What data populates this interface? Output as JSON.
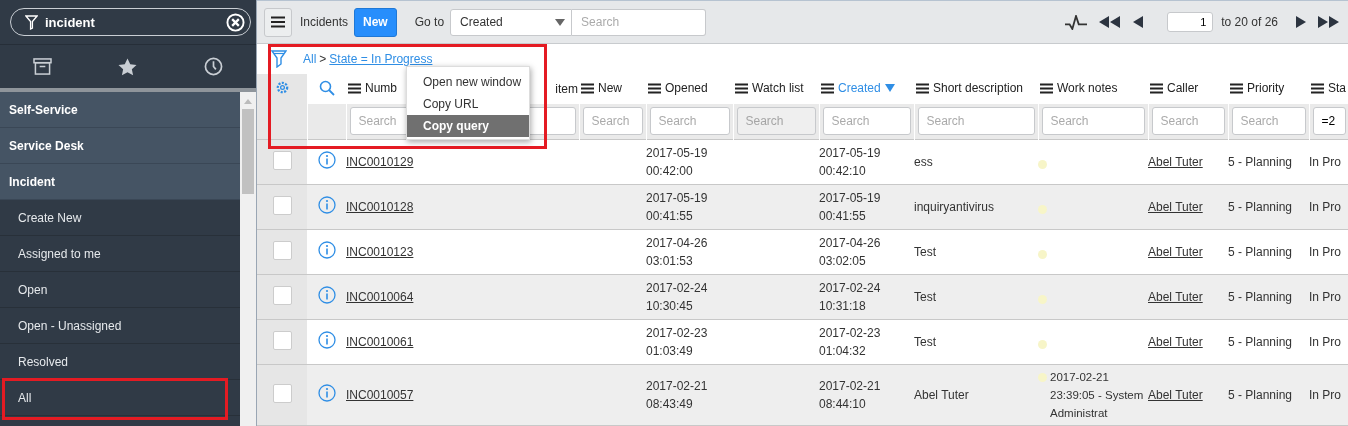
{
  "sidebar": {
    "filter": {
      "value": "incident"
    },
    "tabs": [
      {
        "kind": "box",
        "selected": false
      },
      {
        "kind": "star",
        "selected": false
      },
      {
        "kind": "clock",
        "selected": false
      }
    ],
    "items": [
      {
        "label": "Self-Service",
        "kind": "module"
      },
      {
        "label": "Service Desk",
        "kind": "module"
      },
      {
        "label": "Incident",
        "kind": "module"
      },
      {
        "label": "Create New",
        "kind": "link"
      },
      {
        "label": "Assigned to me",
        "kind": "link"
      },
      {
        "label": "Open",
        "kind": "link"
      },
      {
        "label": "Open - Unassigned",
        "kind": "link"
      },
      {
        "label": "Resolved",
        "kind": "link"
      },
      {
        "label": "All",
        "kind": "link"
      }
    ]
  },
  "toolbar": {
    "title": "Incidents",
    "new_button": "New",
    "goto_label": "Go to",
    "goto_field": "Created",
    "search": {
      "placeholder": "Search"
    },
    "page": "1",
    "range": "to 20 of 26"
  },
  "breadcrumb": {
    "root": "All",
    "separator": ">",
    "condition": "State = In Progress"
  },
  "context_menu": [
    {
      "label": "Open new window",
      "selected": false
    },
    {
      "label": "Copy URL",
      "selected": false
    },
    {
      "label": "Copy query",
      "selected": true
    }
  ],
  "table": {
    "columns": [
      {
        "label": "Numb",
        "sorted": false,
        "filter": {
          "placeholder": "Search",
          "disabled": false
        }
      },
      {
        "label": "item",
        "sorted": false,
        "filter": {
          "disabled": false
        }
      },
      {
        "label": "New",
        "sorted": false,
        "filter": {
          "placeholder": "Search",
          "disabled": false
        }
      },
      {
        "label": "Opened",
        "sorted": false,
        "filter": {
          "placeholder": "Search",
          "disabled": false
        }
      },
      {
        "label": "Watch list",
        "sorted": false,
        "filter": {
          "placeholder": "Search",
          "disabled": true
        }
      },
      {
        "label": "Created",
        "sorted": true,
        "filter": {
          "placeholder": "Search",
          "disabled": false
        }
      },
      {
        "label": "Short description",
        "sorted": false,
        "filter": {
          "placeholder": "Search",
          "disabled": false
        }
      },
      {
        "label": "Work notes",
        "sorted": false,
        "filter": {
          "placeholder": "Search",
          "disabled": false
        }
      },
      {
        "label": "Caller",
        "sorted": false,
        "filter": {
          "placeholder": "Search",
          "disabled": false
        }
      },
      {
        "label": "Priority",
        "sorted": false,
        "filter": {
          "placeholder": "Search",
          "disabled": false
        }
      },
      {
        "label": "Sta",
        "sorted": false,
        "filter": {
          "value": "=2",
          "disabled": false
        }
      }
    ],
    "rows": [
      {
        "checked": false,
        "number": "INC0010129",
        "opened": [
          "2017-05-19",
          "00:42:00"
        ],
        "created": [
          "2017-05-19",
          "00:42:10"
        ],
        "short_description": "ess",
        "work_notes": [],
        "caller": "Abel Tuter",
        "priority": "5 - Planning",
        "state": "In Pro"
      },
      {
        "checked": false,
        "number": "INC0010128",
        "opened": [
          "2017-05-19",
          "00:41:55"
        ],
        "created": [
          "2017-05-19",
          "00:41:55"
        ],
        "short_description": "inquiryantivirus",
        "work_notes": [],
        "caller": "Abel Tuter",
        "priority": "5 - Planning",
        "state": "In Pro"
      },
      {
        "checked": false,
        "number": "INC0010123",
        "opened": [
          "2017-04-26",
          "03:01:53"
        ],
        "created": [
          "2017-04-26",
          "03:02:05"
        ],
        "short_description": "Test",
        "work_notes": [],
        "caller": "Abel Tuter",
        "priority": "5 - Planning",
        "state": "In Pro"
      },
      {
        "checked": false,
        "number": "INC0010064",
        "opened": [
          "2017-02-24",
          "10:30:45"
        ],
        "created": [
          "2017-02-24",
          "10:31:18"
        ],
        "short_description": "Test",
        "work_notes": [],
        "caller": "Abel Tuter",
        "priority": "5 - Planning",
        "state": "In Pro"
      },
      {
        "checked": false,
        "number": "INC0010061",
        "opened": [
          "2017-02-23",
          "01:03:49"
        ],
        "created": [
          "2017-02-23",
          "01:04:32"
        ],
        "short_description": "Test",
        "work_notes": [],
        "caller": "Abel Tuter",
        "priority": "5 - Planning",
        "state": "In Pro"
      },
      {
        "checked": false,
        "number": "INC0010057",
        "opened": [
          "2017-02-21",
          "08:43:49"
        ],
        "created": [
          "2017-02-21",
          "08:44:10"
        ],
        "short_description": "Abel Tuter",
        "work_notes": [
          "2017-02-21",
          "23:39:05 - System",
          "Administrat"
        ],
        "caller": "Abel Tuter",
        "priority": "5 - Planning",
        "state": "In Pro"
      }
    ]
  }
}
